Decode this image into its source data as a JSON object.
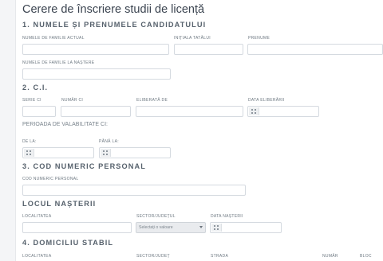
{
  "page_title": "Cerere de înscriere studii de licență",
  "section1": {
    "heading": "1. NUMELE ȘI PRENUMELE CANDIDATULUI",
    "labels": {
      "current_last_name": "NUMELE DE FAMILIE ACTUAL",
      "father_initial": "INIȚIALA TATĂLUI",
      "first_name": "PRENUME",
      "birth_last_name": "NUMELE DE FAMILIE LA NAȘTERE"
    }
  },
  "section2": {
    "heading": "2. C.I.",
    "labels": {
      "series": "SERIE CI",
      "number": "NUMĂR CI",
      "issued_by": "ELIBERATĂ DE",
      "issue_date": "DATA ELIBERĂRII"
    },
    "validity_label": "PERIOADA DE VALABILITATE CI:",
    "validity": {
      "from": "DE LA:",
      "to": "PÂNĂ LA:"
    }
  },
  "section3": {
    "heading": "3. COD NUMERIC PERSONAL",
    "label": "COD NUMERIC PERSONAL"
  },
  "birthplace": {
    "heading": "LOCUL NAȘTERII",
    "labels": {
      "locality": "LOCALITATEA",
      "county": "SECTOR/JUDEȚUL",
      "birth_date": "DATA NAȘTERII"
    },
    "county_select_value": "Selectați o valoare"
  },
  "section4": {
    "heading": "4. DOMICILIU STABIL",
    "labels": {
      "locality": "LOCALITATEA",
      "county": "SECTOR/JUDEȚ",
      "street": "STRADA",
      "number": "NUMĂR",
      "block": "BLOC"
    }
  },
  "icons": {
    "calendar": "calendar-icon",
    "dropdown": "chevron-down-icon"
  }
}
